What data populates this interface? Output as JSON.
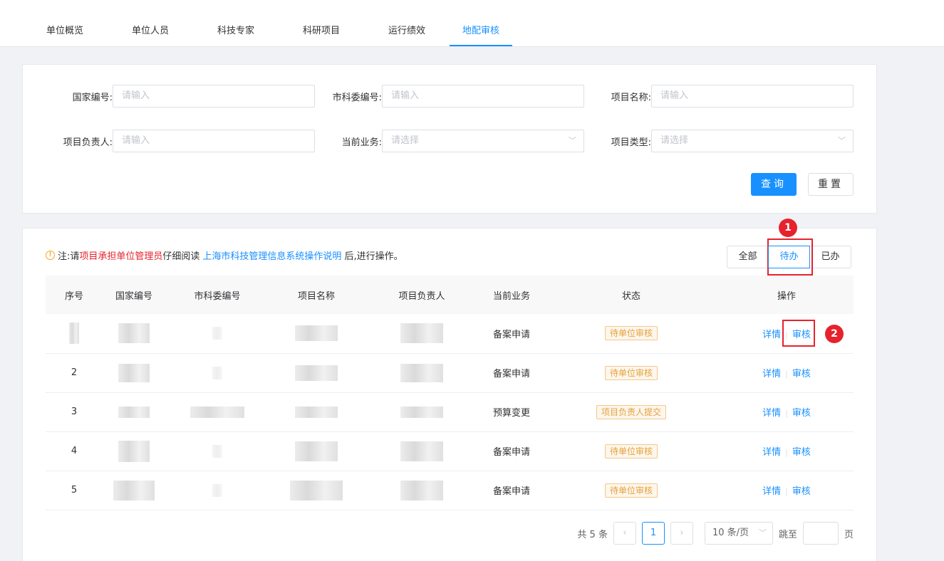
{
  "tabs": [
    "单位概览",
    "单位人员",
    "科技专家",
    "科研项目",
    "运行绩效",
    "地配审核"
  ],
  "active_tab": 5,
  "filter": {
    "national_no_label": "国家编号:",
    "city_no_label": "市科委编号:",
    "project_name_label": "项目名称:",
    "leader_label": "项目负责人:",
    "business_label": "当前业务:",
    "type_label": "项目类型:",
    "input_placeholder": "请输入",
    "select_placeholder": "请选择",
    "query_label": "查询",
    "reset_label": "重置"
  },
  "note": {
    "prefix": "注:请",
    "highlight": "项目承担单位管理员",
    "middle": "仔细阅读",
    "link": "上海市科技管理信息系统操作说明",
    "suffix": "后,进行操作。"
  },
  "segment": [
    "全部",
    "待办",
    "已办"
  ],
  "markers": [
    "1",
    "2"
  ],
  "table": {
    "headers": [
      "序号",
      "国家编号",
      "市科委编号",
      "项目名称",
      "项目负责人",
      "当前业务",
      "状态",
      "操作"
    ],
    "rows": [
      {
        "index": "",
        "business": "备案申请",
        "status": "待单位审核"
      },
      {
        "index": "2",
        "business": "备案申请",
        "status": "待单位审核"
      },
      {
        "index": "3",
        "business": "预算变更",
        "status": "项目负责人提交"
      },
      {
        "index": "4",
        "business": "备案申请",
        "status": "待单位审核"
      },
      {
        "index": "5",
        "business": "备案申请",
        "status": "待单位审核"
      }
    ],
    "detail_label": "详情",
    "audit_label": "审核"
  },
  "pager": {
    "total": "共 5 条",
    "current": "1",
    "size": "10 条/页",
    "jump": "跳至",
    "page_unit": "页"
  },
  "colors": {
    "primary": "#1890ff",
    "warning": "#e6a23c",
    "highlight": "#e6222d"
  }
}
